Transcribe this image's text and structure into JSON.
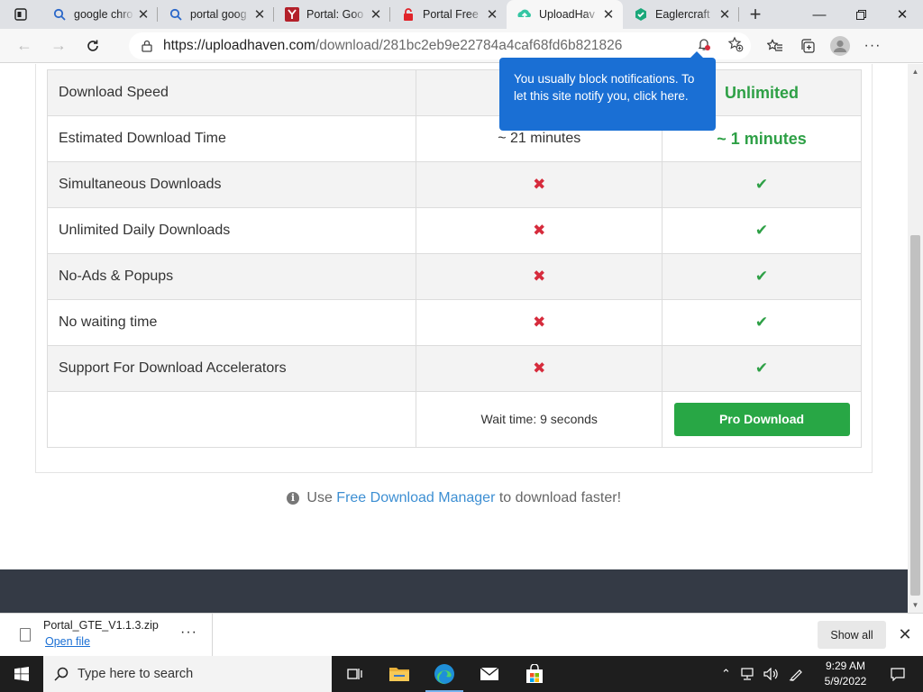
{
  "browser": {
    "tabs": [
      {
        "title": "google chro",
        "icon": "search-icon",
        "active": false
      },
      {
        "title": "portal goog",
        "icon": "search-icon",
        "active": false
      },
      {
        "title": "Portal: Goo",
        "icon": "y-site-icon",
        "active": false
      },
      {
        "title": "Portal Free",
        "icon": "lock-favicon-icon",
        "active": false
      },
      {
        "title": "UploadHav",
        "icon": "uploadhaven-icon",
        "active": true
      },
      {
        "title": "Eaglercraft",
        "icon": "eaglercraft-icon",
        "active": false
      }
    ],
    "url_domain": "https://uploadhaven.com",
    "url_path": "/download/281bc2eb9e22784a4caf68fd6b821826",
    "notification_popup": "You usually block notifications. To let this site notify you, click here."
  },
  "comparison": {
    "rows": [
      {
        "feature": "Download Speed",
        "free": "",
        "pro": "Unlimited",
        "free_kind": "text",
        "pro_kind": "text"
      },
      {
        "feature": "Estimated Download Time",
        "free": "~ 21 minutes",
        "pro": "~ 1 minutes",
        "free_kind": "text",
        "pro_kind": "text"
      },
      {
        "feature": "Simultaneous Downloads",
        "free": "✖",
        "pro": "✔",
        "free_kind": "cross",
        "pro_kind": "check"
      },
      {
        "feature": "Unlimited Daily Downloads",
        "free": "✖",
        "pro": "✔",
        "free_kind": "cross",
        "pro_kind": "check"
      },
      {
        "feature": "No-Ads & Popups",
        "free": "✖",
        "pro": "✔",
        "free_kind": "cross",
        "pro_kind": "check"
      },
      {
        "feature": "No waiting time",
        "free": "✖",
        "pro": "✔",
        "free_kind": "cross",
        "pro_kind": "check"
      },
      {
        "feature": "Support For Download Accelerators",
        "free": "✖",
        "pro": "✔",
        "free_kind": "cross",
        "pro_kind": "check"
      }
    ],
    "wait_time": "Wait time: 9 seconds",
    "pro_button": "Pro Download"
  },
  "fdm_note": {
    "prefix": "Use",
    "link": "Free Download Manager",
    "suffix": "to download faster!"
  },
  "download_bar": {
    "file_name": "Portal_GTE_V1.1.3.zip",
    "open_label": "Open file",
    "show_all": "Show all"
  },
  "taskbar": {
    "search_placeholder": "Type here to search",
    "time": "9:29 AM",
    "date": "5/9/2022"
  },
  "colors": {
    "accent_green": "#28a745",
    "cross_red": "#d62b3c",
    "link_blue": "#3d8fd3",
    "popup_blue": "#1a6fd4",
    "footer_dark": "#343a45"
  }
}
